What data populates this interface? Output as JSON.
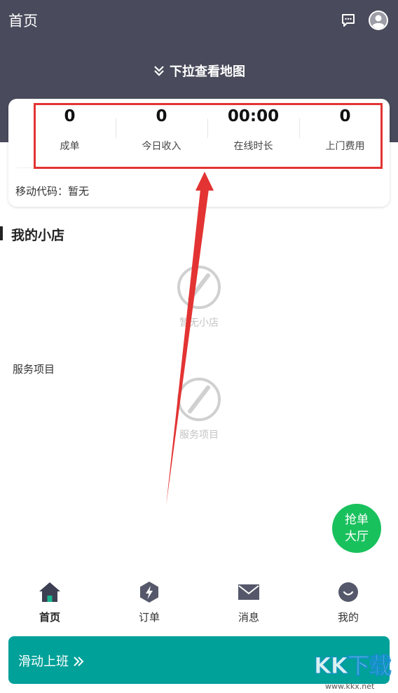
{
  "header": {
    "title": "首页",
    "chat_icon": "chat-bubble-icon",
    "avatar_icon": "user-avatar-icon",
    "pull_label": "下拉查看地图",
    "background": "#494b5c"
  },
  "stats": [
    {
      "value": "0",
      "label": "成单"
    },
    {
      "value": "0",
      "label": "今日收入"
    },
    {
      "value": "00:00",
      "label": "在线时长"
    },
    {
      "value": "0",
      "label": "上门费用"
    }
  ],
  "mobile_code": "移动代码：暂无",
  "shop_section": {
    "title": "我的小店",
    "empty_text": "暂无小店"
  },
  "service_section": {
    "title": "服务项目",
    "empty_text": "服务项目"
  },
  "float_button": {
    "line1": "抢单",
    "line2": "大厅",
    "color": "#19c15d"
  },
  "tabs": [
    {
      "label": "首页",
      "icon": "home-icon",
      "active": true
    },
    {
      "label": "订单",
      "icon": "order-bolt-icon",
      "active": false
    },
    {
      "label": "消息",
      "icon": "mail-icon",
      "active": false
    },
    {
      "label": "我的",
      "icon": "smile-face-icon",
      "active": false
    }
  ],
  "slide_bar": {
    "label": "滑动上班",
    "color": "#00a199"
  },
  "annotation": {
    "highlight_color": "#e33333"
  },
  "watermark": {
    "text": "KK下载",
    "url": "www.kkx.net"
  }
}
